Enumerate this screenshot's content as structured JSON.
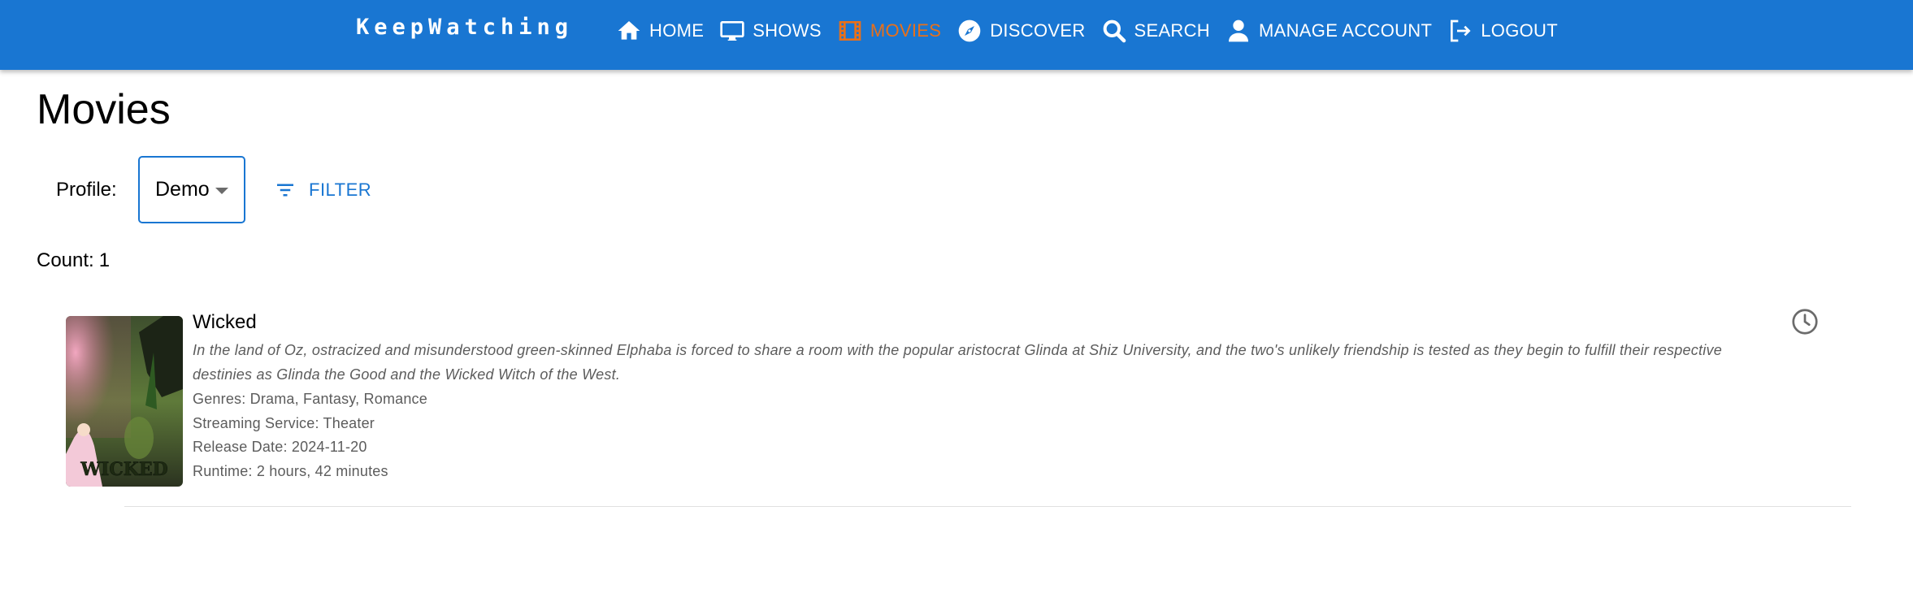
{
  "app": {
    "brand": "KeepWatching"
  },
  "nav": {
    "items": [
      {
        "label": "HOME",
        "icon": "home-icon"
      },
      {
        "label": "SHOWS",
        "icon": "tv-icon"
      },
      {
        "label": "MOVIES",
        "icon": "film-icon",
        "active": true
      },
      {
        "label": "DISCOVER",
        "icon": "compass-icon"
      },
      {
        "label": "SEARCH",
        "icon": "search-icon"
      },
      {
        "label": "MANAGE ACCOUNT",
        "icon": "person-icon"
      },
      {
        "label": "LOGOUT",
        "icon": "logout-icon"
      }
    ]
  },
  "page": {
    "title": "Movies",
    "profile_label": "Profile:",
    "profile_value": "Demo",
    "filter_label": "FILTER",
    "count_label": "Count:",
    "count_value": "1"
  },
  "movies": [
    {
      "title": "Wicked",
      "description": "In the land of Oz, ostracized and misunderstood green-skinned Elphaba is forced to share a room with the popular aristocrat Glinda at Shiz University, and the two's unlikely friendship is tested as they begin to fulfill their respective destinies as Glinda the Good and the Wicked Witch of the West.",
      "genres": "Genres: Drama, Fantasy, Romance",
      "streaming": "Streaming Service: Theater",
      "release_date": "Release Date: 2024-11-20",
      "runtime": "Runtime: 2 hours, 42 minutes",
      "poster_text": "WICKED",
      "status_icon": "clock-icon"
    }
  ],
  "colors": {
    "appbar": "#1976d2",
    "active_nav": "#e8701a",
    "accent": "#1976d2",
    "secondary_text": "#5c5c5c"
  }
}
